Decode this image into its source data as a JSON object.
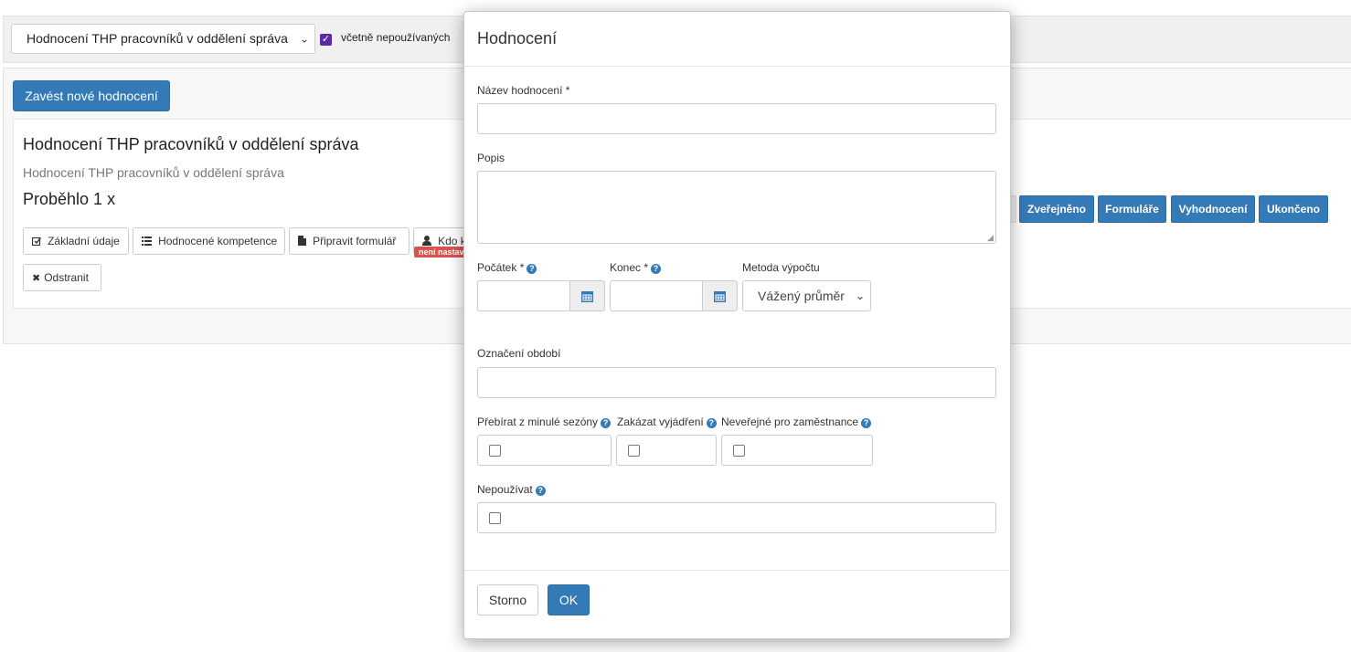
{
  "filter": {
    "selected_evaluation": "Hodnocení THP pracovníků v oddělení správa",
    "include_unused_label": "včetně nepoužívaných",
    "include_unused_checked": true
  },
  "actions": {
    "new_evaluation_label": "Zavést nové hodnocení"
  },
  "evaluation_card": {
    "title": "Hodnocení THP pracovníků v oddělení správa",
    "subtitle": "Hodnocení THP pracovníků v oddělení správa",
    "count_text": "Proběhlo 1 x",
    "buttons": {
      "basic": "Základní údaje",
      "competences": "Hodnocené kompetence",
      "prepare_form": "Připravit formulář",
      "who": "Kdo k",
      "remove": "Odstranit"
    },
    "who_badge": "není nastav",
    "status_buttons": [
      "Zveřejněno",
      "Formuláře",
      "Vyhodnocení",
      "Ukončeno"
    ]
  },
  "modal": {
    "title": "Hodnocení",
    "fields": {
      "name_label": "Název hodnocení *",
      "name_value": "",
      "description_label": "Popis",
      "description_value": "",
      "start_label": "Počátek *",
      "start_value": "",
      "end_label": "Konec *",
      "end_value": "",
      "method_label": "Metoda výpočtu",
      "method_selected": "Vážený průměr",
      "period_label": "Označení období",
      "period_value": "",
      "carry_over_label": "Přebírat z minulé sezóny",
      "forbid_comment_label": "Zakázat vyjádření",
      "non_public_label": "Neveřejné pro zaměstnance",
      "unused_label": "Nepoužívat"
    },
    "footer": {
      "cancel_label": "Storno",
      "ok_label": "OK"
    }
  },
  "icons": {
    "help": "?",
    "remove": "✖",
    "chevron": "⌄"
  },
  "colors": {
    "primary": "#337ab7",
    "danger": "#d9534f",
    "checkbox_checked": "#5b2aa8"
  }
}
